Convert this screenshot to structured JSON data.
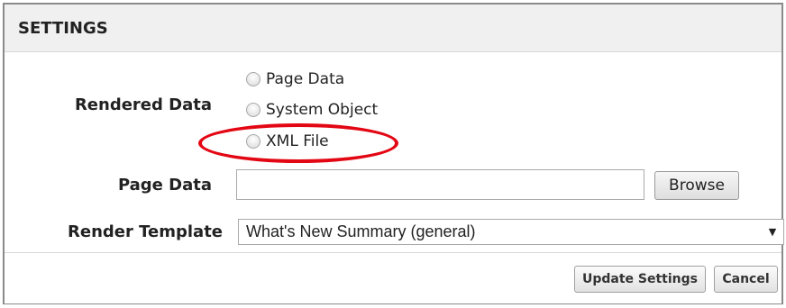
{
  "panel": {
    "title": "SETTINGS"
  },
  "rendered_data": {
    "label": "Rendered Data",
    "options": [
      {
        "label": "Page Data",
        "selected": false
      },
      {
        "label": "System Object",
        "selected": false
      },
      {
        "label": "XML File",
        "selected": false
      }
    ],
    "highlighted_option": "XML File",
    "highlight_color": "#e30613"
  },
  "page_data": {
    "label": "Page Data",
    "value": "",
    "browse_label": "Browse"
  },
  "render_template": {
    "label": "Render Template",
    "selected_value": "What's New Summary (general)"
  },
  "footer": {
    "update_label": "Update Settings",
    "cancel_label": "Cancel"
  }
}
